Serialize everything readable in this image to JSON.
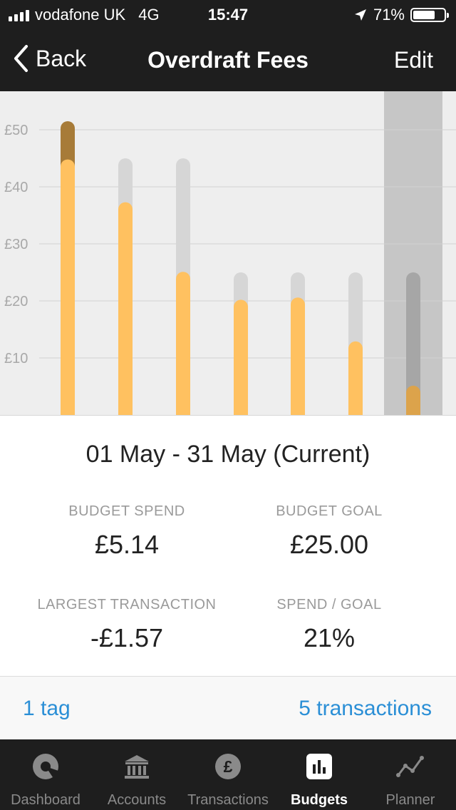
{
  "status_bar": {
    "carrier": "vodafone UK",
    "network": "4G",
    "time": "15:47",
    "battery": "71%",
    "battery_level": 0.71
  },
  "nav": {
    "back_label": "Back",
    "title": "Overdraft Fees",
    "edit_label": "Edit"
  },
  "chart_data": {
    "type": "bar",
    "y_ticks": [
      "£50",
      "£40",
      "£30",
      "£20",
      "£10"
    ],
    "ylim": [
      0,
      50
    ],
    "grid": true,
    "series": [
      {
        "values": [
          25,
          45,
          45,
          25,
          25,
          25,
          25
        ]
      },
      {
        "values": [
          44.8,
          37.3,
          25.1,
          20.2,
          20.6,
          12.9,
          5.14
        ]
      }
    ],
    "overspend_values": [
      51.5,
      null,
      null,
      null,
      null,
      null,
      null
    ],
    "current_index": 6,
    "colors": {
      "spend": "#ffc160",
      "goal": "#d6d6d6",
      "overspend": "#a77b38",
      "current_spend": "#dca34b",
      "current_goal": "#a6a6a6",
      "current_bg": "#c6c6c6"
    }
  },
  "summary": {
    "period": "01 May - 31 May (Current)",
    "budget_spend_label": "BUDGET SPEND",
    "budget_spend_value": "£5.14",
    "budget_goal_label": "BUDGET GOAL",
    "budget_goal_value": "£25.00",
    "largest_label": "LARGEST TRANSACTION",
    "largest_value": "-£1.57",
    "ratio_label": "SPEND / GOAL",
    "ratio_value": "21%"
  },
  "links": {
    "tags": "1 tag",
    "transactions": "5 transactions"
  },
  "tabbar": {
    "active": "Budgets",
    "items": [
      {
        "label": "Dashboard",
        "icon": "dashboard-icon"
      },
      {
        "label": "Accounts",
        "icon": "bank-icon"
      },
      {
        "label": "Transactions",
        "icon": "pound-icon"
      },
      {
        "label": "Budgets",
        "icon": "bar-chart-icon"
      },
      {
        "label": "Planner",
        "icon": "trend-line-icon"
      }
    ]
  }
}
